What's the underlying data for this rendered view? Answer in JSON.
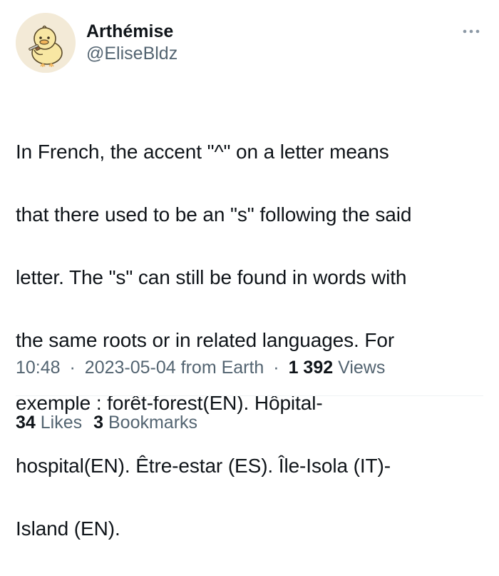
{
  "author": {
    "display_name": "Arthémise",
    "handle": "@EliseBldz",
    "avatar_icon": "duck-avatar-icon"
  },
  "menu": {
    "more_icon": "more-options-icon"
  },
  "tweet": {
    "text_lines": [
      "In French, the accent \"^\" on a letter means",
      "that there used to be an \"s\" following the said",
      "letter. The \"s\" can still be found in words with",
      "the same roots or in related languages. For",
      "exemple : forêt-forest(EN). Hôpital-",
      "hospital(EN). Être-estar (ES). Île-Isola (IT)-",
      "Island (EN)."
    ]
  },
  "meta": {
    "time": "10:48",
    "separator": "·",
    "date": "2023-05-04",
    "source": "from Earth",
    "views_count": "1 392",
    "views_label": "Views"
  },
  "stats": {
    "likes_count": "34",
    "likes_label": "Likes",
    "bookmarks_count": "3",
    "bookmarks_label": "Bookmarks"
  },
  "colors": {
    "text_primary": "#0f1419",
    "text_secondary": "#536471",
    "avatar_background": "#f3ead7",
    "duck_body": "#f8e7a3",
    "divider": "#eff3f4"
  }
}
